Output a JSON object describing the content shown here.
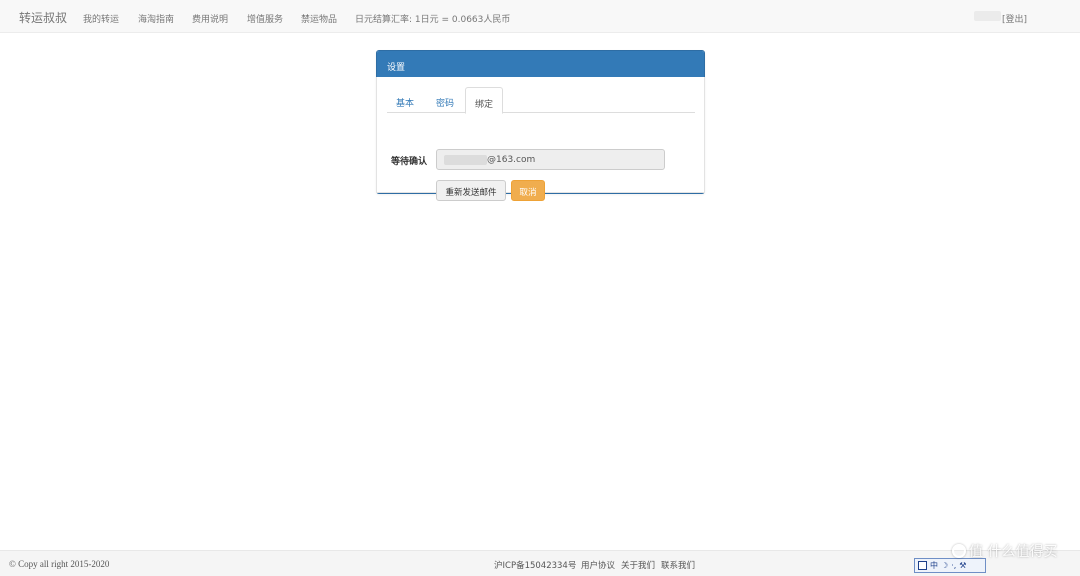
{
  "navbar": {
    "brand": "转运叔叔",
    "items": [
      "我的转运",
      "海淘指南",
      "费用说明",
      "增值服务",
      "禁运物品"
    ],
    "exchange_rate": "日元结算汇率: 1日元 = 0.0663人民币",
    "logout": "[登出]"
  },
  "panel": {
    "title": "设置",
    "tabs": [
      "基本",
      "密码",
      "绑定"
    ],
    "active_tab": "绑定",
    "field_label": "等待确认",
    "email_value": "@163.com",
    "resend_button": "重新发送邮件",
    "cancel_button": "取消"
  },
  "footer": {
    "copyright": "© Copy all right 2015-2020",
    "links": [
      "沪ICP备15042334号",
      "用户协议",
      "关于我们",
      "联系我们"
    ]
  },
  "ime": {
    "mode": "中",
    "icons": [
      "ime-logo-icon",
      "moon-icon",
      "punctuation-icon",
      "wrench-icon"
    ]
  },
  "watermark": "值 什么值得买",
  "colors": {
    "panel_primary": "#337ab7",
    "cancel_warning": "#f0ad4e",
    "navbar_bg": "#f8f8f8"
  }
}
